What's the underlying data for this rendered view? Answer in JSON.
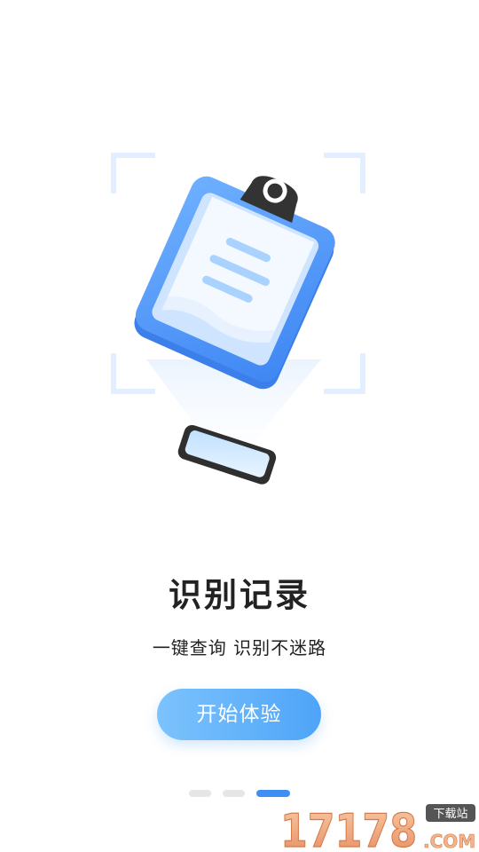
{
  "onboarding": {
    "title": "识别记录",
    "subtitle": "一键查询 识别不迷路",
    "start_button": "开始体验",
    "page_indicator": {
      "total": 3,
      "current": 3
    }
  },
  "watermark": {
    "number": "17178",
    "tag": "下载站",
    "suffix": ".COM"
  },
  "colors": {
    "accent": "#4ea4f8",
    "accent_light": "#7cc3fd",
    "active_dot": "#3d8ff5",
    "inactive_dot": "#e6e6e6",
    "text": "#222222"
  }
}
